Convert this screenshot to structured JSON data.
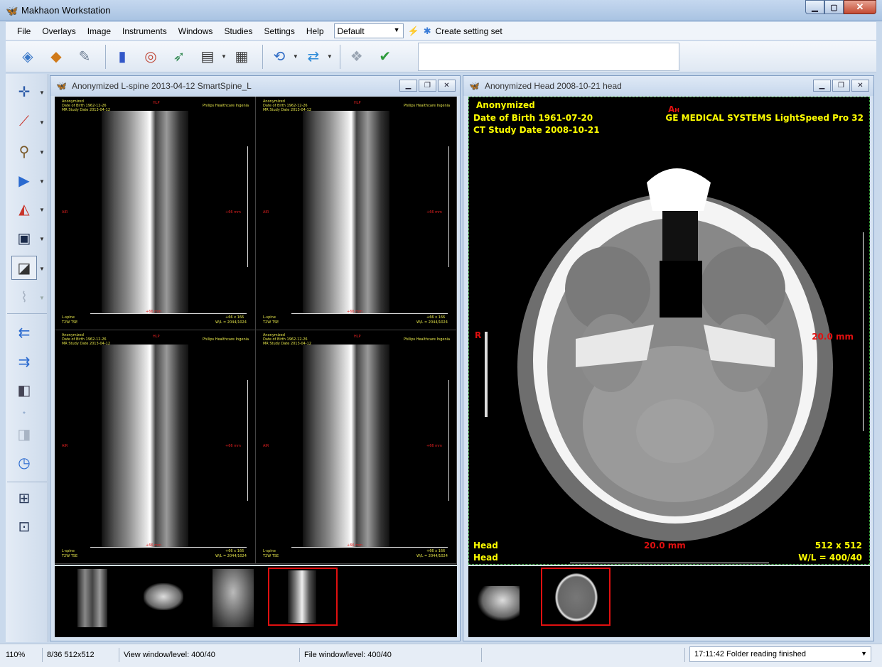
{
  "window": {
    "title": "Makhaon Workstation",
    "minimize": "▁",
    "maximize": "▢",
    "close": "✕"
  },
  "menu": {
    "items": [
      "File",
      "Overlays",
      "Image",
      "Instruments",
      "Windows",
      "Studies",
      "Settings",
      "Help"
    ],
    "setting_set_value": "Default",
    "create_setting_set": "Create setting set"
  },
  "left_window": {
    "title": "Anonymized L-spine 2013-04-12 SmartSpine_L",
    "overlay": {
      "line1": "Anonymized",
      "line2": "Date of Birth 1962-12-26",
      "line3": "MR Study Date 2013-04-12",
      "top_right": "Philips Healthcare Ingenia",
      "orientation_top": "HLP",
      "orientation_left": "AIR",
      "orientation_right": "+66 mm",
      "bottom_left_1": "L-spine",
      "bottom_left_2": "T2W TSE",
      "bottom_center": "+66 mm",
      "bottom_right_1": "+66 x 166",
      "bottom_right_2": "W/L = 2044/1024"
    }
  },
  "right_window": {
    "title": "Anonymized Head 2008-10-21 head",
    "overlay": {
      "patient": "Anonymized",
      "dob": "Date of Birth 1961-07-20",
      "study_date": "CT Study Date 2008-10-21",
      "device": "GE MEDICAL SYSTEMS LightSpeed Pro 32",
      "orientation_top": "A",
      "orientation_top_sub": "H",
      "orientation_left": "R",
      "scale_right": "20.0 mm",
      "scale_bottom": "20.0 mm",
      "bottom_left_1": "Head",
      "bottom_left_2": "Head",
      "matrix": "512 x 512",
      "window_level": "W/L = 400/40"
    }
  },
  "statusbar": {
    "zoom": "110%",
    "frame": "8/36 512x512",
    "view_wl": "View window/level: 400/40",
    "file_wl": "File window/level: 400/40",
    "status": "17:11:42 Folder reading finished"
  },
  "colors": {
    "overlay_yellow": "#ffff00",
    "overlay_red": "#e01010",
    "selection_red": "#e01010"
  }
}
